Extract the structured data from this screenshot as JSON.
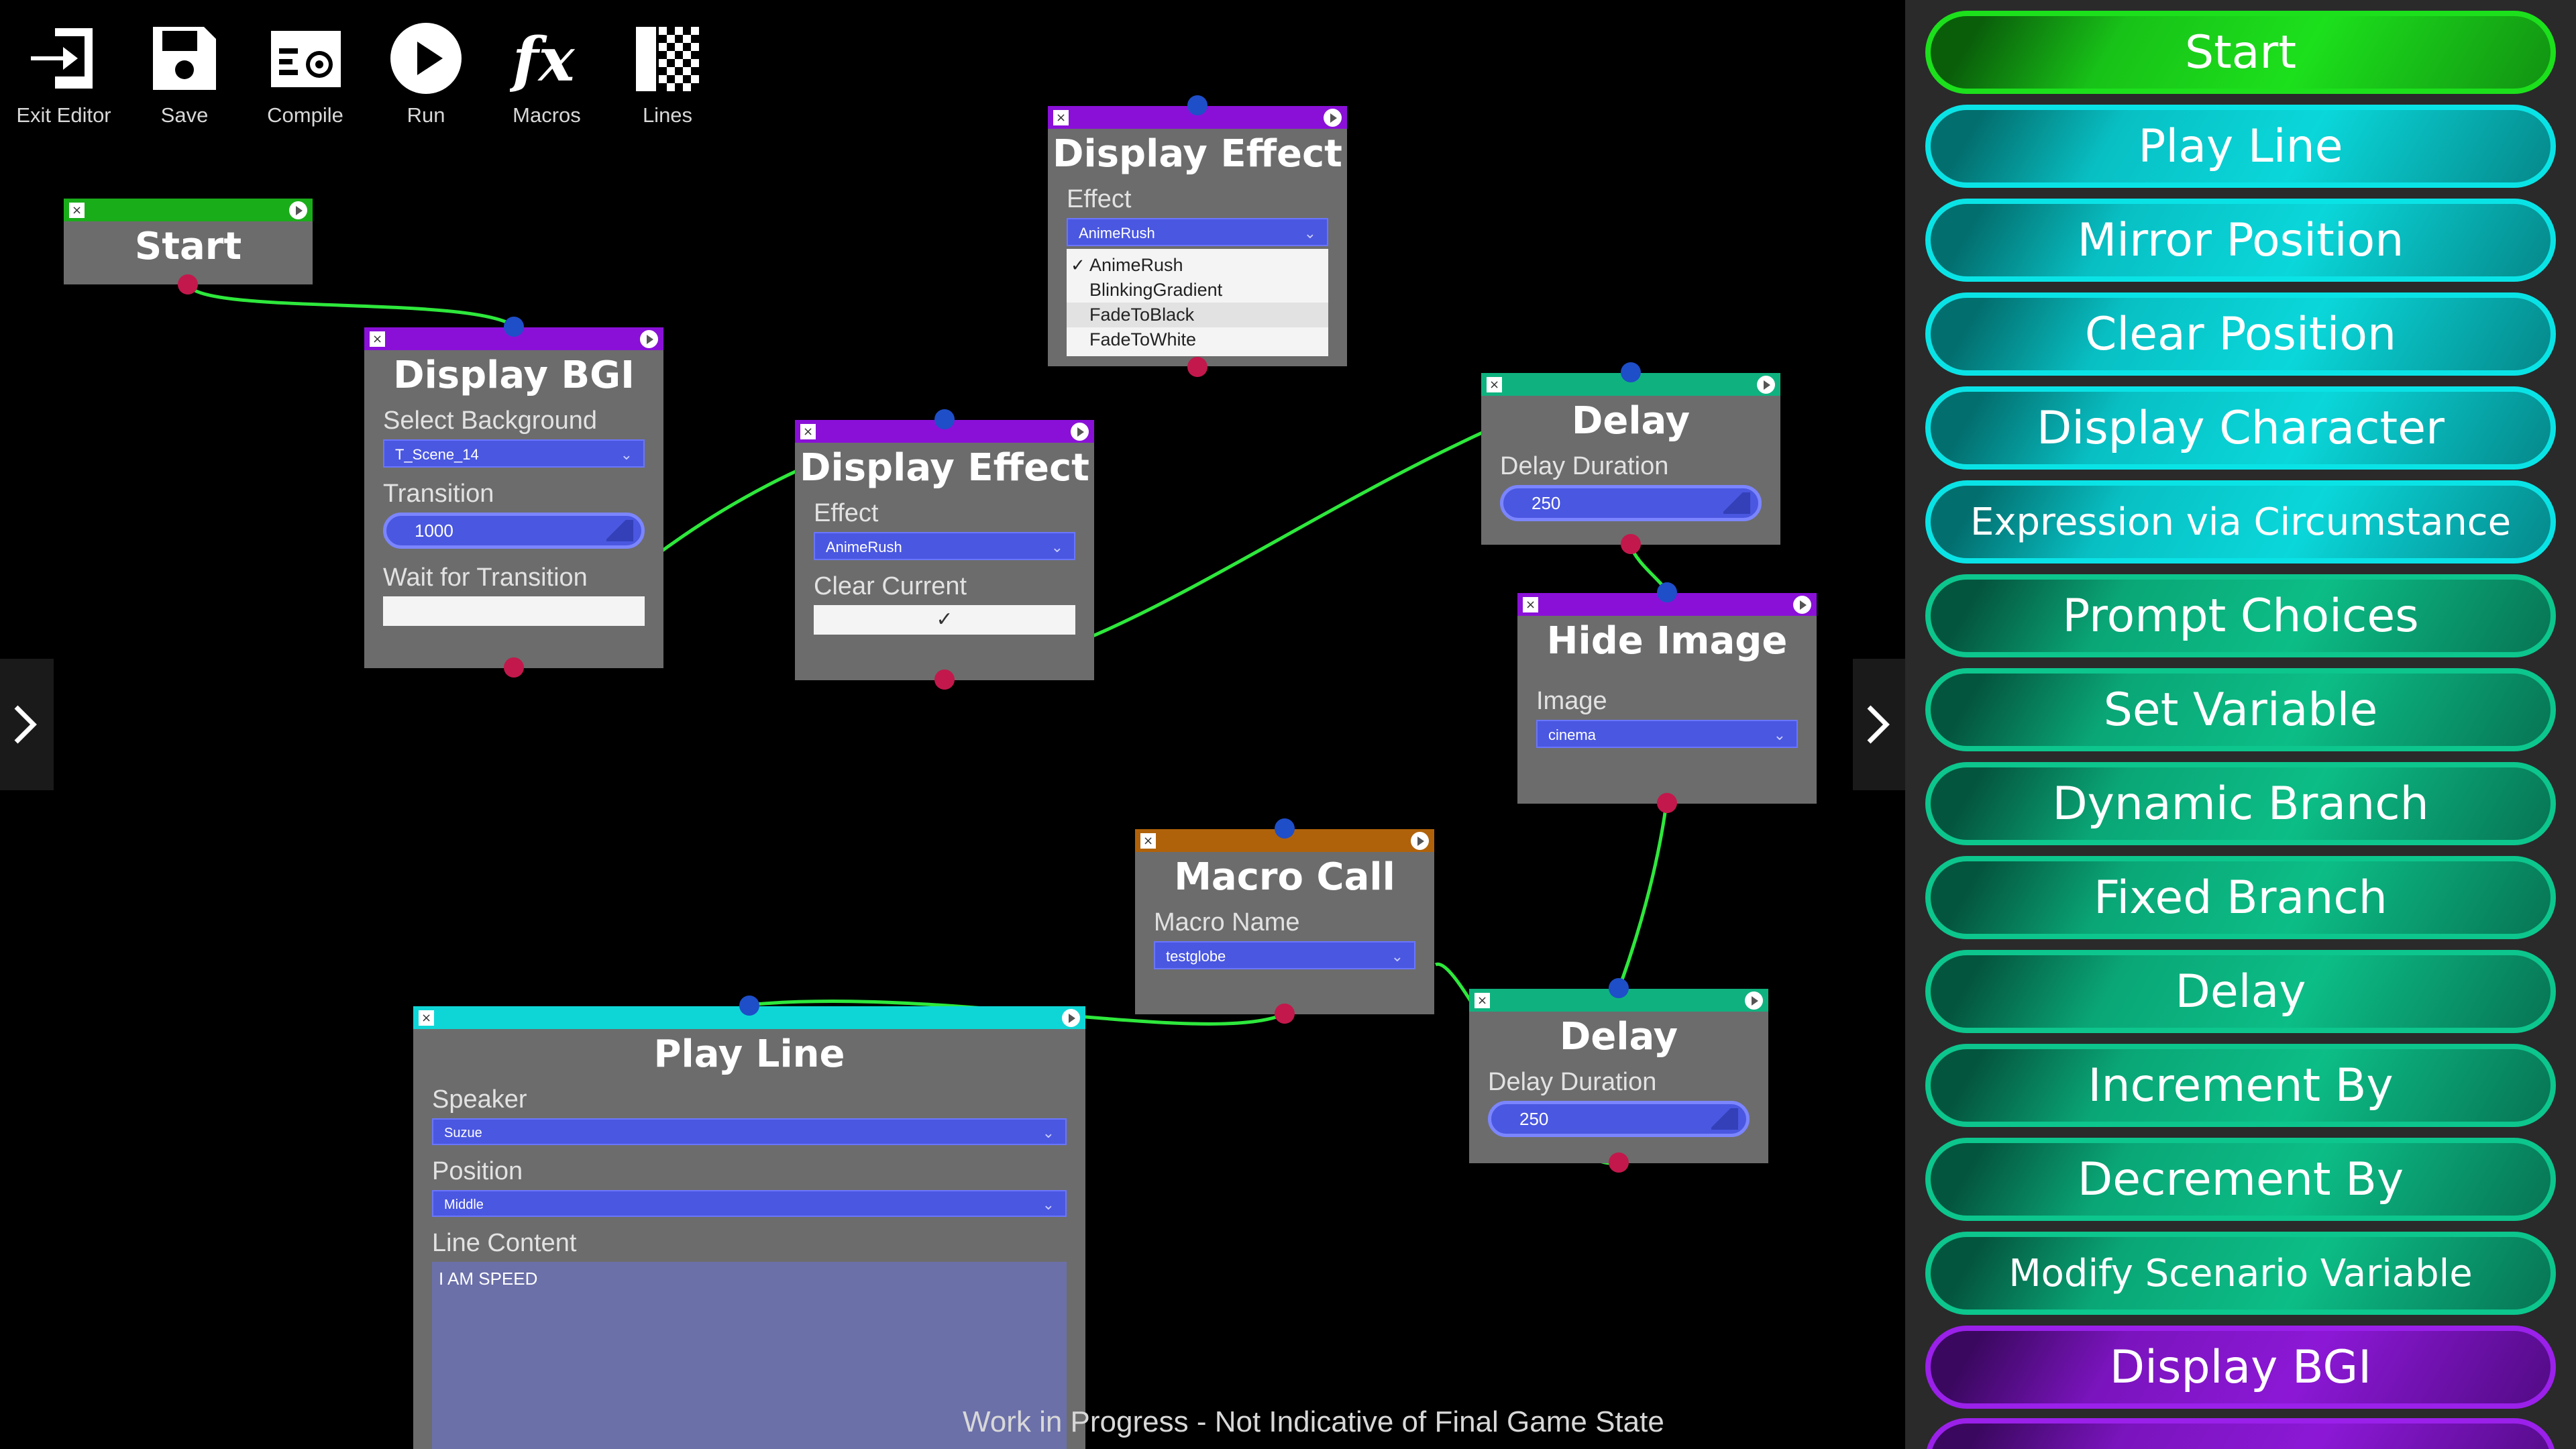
{
  "toolbar": {
    "exit": "Exit Editor",
    "save": "Save",
    "compile": "Compile",
    "run": "Run",
    "macros": "Macros",
    "lines": "Lines"
  },
  "nodes": {
    "start": {
      "title": "Start"
    },
    "display_bgi": {
      "title": "Display BGI",
      "f1": "Select Background",
      "v1": "T_Scene_14",
      "f2": "Transition",
      "v2": "1000",
      "f3": "Wait for Transition"
    },
    "display_effect_open": {
      "title": "Display Effect",
      "f1": "Effect",
      "v1": "AnimeRush",
      "options": [
        "AnimeRush",
        "BlinkingGradient",
        "FadeToBlack",
        "FadeToWhite"
      ]
    },
    "display_effect": {
      "title": "Display Effect",
      "f1": "Effect",
      "v1": "AnimeRush",
      "f2": "Clear Current",
      "check": "✓"
    },
    "delay_1": {
      "title": "Delay",
      "f1": "Delay Duration",
      "v1": "250"
    },
    "hide_image": {
      "title": "Hide Image",
      "f1": "Image",
      "v1": "cinema"
    },
    "macro_call": {
      "title": "Macro Call",
      "f1": "Macro Name",
      "v1": "testglobe"
    },
    "delay_2": {
      "title": "Delay",
      "f1": "Delay Duration",
      "v1": "250"
    },
    "play_line": {
      "title": "Play Line",
      "f1": "Speaker",
      "v1": "Suzue",
      "f2": "Position",
      "v2": "Middle",
      "f3": "Line Content",
      "v3": "I AM SPEED"
    }
  },
  "palette": [
    "Start",
    "Play Line",
    "Mirror Position",
    "Clear Position",
    "Display Character",
    "Expression via Circumstance",
    "Prompt Choices",
    "Set Variable",
    "Dynamic Branch",
    "Fixed Branch",
    "Delay",
    "Increment By",
    "Decrement By",
    "Modify Scenario Variable",
    "Display BGI"
  ],
  "footer": {
    "wip": "Work in Progress - Not Indicative of Final Game State"
  },
  "colors": {
    "green_header": "#1aad1a",
    "purple_header": "#8a10d8",
    "teal_header": "#0fb27f",
    "cyan_header": "#0fd6d6",
    "orange_header": "#b0620a",
    "wire": "#2ee83c",
    "port_in": "#1e4ec8",
    "port_out": "#c3184c"
  }
}
